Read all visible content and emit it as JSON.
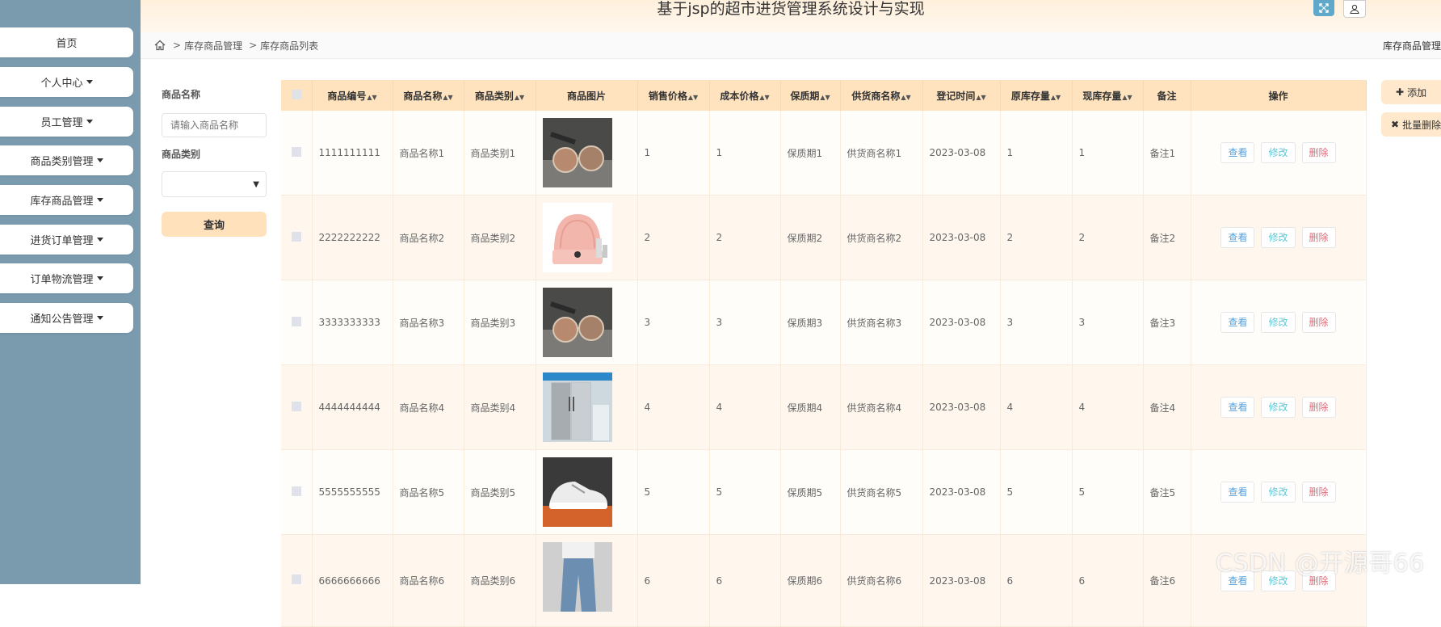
{
  "header": {
    "title": "基于jsp的超市进货管理系统设计与实现"
  },
  "sidebar": {
    "items": [
      {
        "label": "首页",
        "dropdown": false
      },
      {
        "label": "个人中心",
        "dropdown": true
      },
      {
        "label": "员工管理",
        "dropdown": true
      },
      {
        "label": "商品类别管理",
        "dropdown": true
      },
      {
        "label": "库存商品管理",
        "dropdown": true
      },
      {
        "label": "进货订单管理",
        "dropdown": true
      },
      {
        "label": "订单物流管理",
        "dropdown": true
      },
      {
        "label": "通知公告管理",
        "dropdown": true
      }
    ]
  },
  "breadcrumb": {
    "items": [
      "库存商品管理",
      "库存商品列表"
    ],
    "right": "库存商品管理"
  },
  "filter": {
    "name_label": "商品名称",
    "name_placeholder": "请输入商品名称",
    "type_label": "商品类别",
    "query_label": "查询"
  },
  "toolbar": {
    "add_label": "添加",
    "batch_delete_label": "批量删除"
  },
  "table": {
    "headers": [
      "商品编号",
      "商品名称",
      "商品类别",
      "商品图片",
      "销售价格",
      "成本价格",
      "保质期",
      "供货商名称",
      "登记时间",
      "原库存量",
      "现库存量",
      "备注",
      "操作"
    ],
    "actions": {
      "view": "查看",
      "edit": "修改",
      "delete": "删除"
    },
    "rows": [
      {
        "id": "1111111111",
        "name": "商品名称1",
        "category": "商品类别1",
        "image": "sunglasses",
        "sale": "1",
        "cost": "1",
        "shelf": "保质期1",
        "supplier": "供货商名称1",
        "date": "2023-03-08",
        "orig": "1",
        "curr": "1",
        "note": "备注1"
      },
      {
        "id": "2222222222",
        "name": "商品名称2",
        "category": "商品类别2",
        "image": "cosmetics",
        "sale": "2",
        "cost": "2",
        "shelf": "保质期2",
        "supplier": "供货商名称2",
        "date": "2023-03-08",
        "orig": "2",
        "curr": "2",
        "note": "备注2"
      },
      {
        "id": "3333333333",
        "name": "商品名称3",
        "category": "商品类别3",
        "image": "sunglasses",
        "sale": "3",
        "cost": "3",
        "shelf": "保质期3",
        "supplier": "供货商名称3",
        "date": "2023-03-08",
        "orig": "3",
        "curr": "3",
        "note": "备注3"
      },
      {
        "id": "4444444444",
        "name": "商品名称4",
        "category": "商品类别4",
        "image": "refrigerator",
        "sale": "4",
        "cost": "4",
        "shelf": "保质期4",
        "supplier": "供货商名称4",
        "date": "2023-03-08",
        "orig": "4",
        "curr": "4",
        "note": "备注4"
      },
      {
        "id": "5555555555",
        "name": "商品名称5",
        "category": "商品类别5",
        "image": "sneaker",
        "sale": "5",
        "cost": "5",
        "shelf": "保质期5",
        "supplier": "供货商名称5",
        "date": "2023-03-08",
        "orig": "5",
        "curr": "5",
        "note": "备注5"
      },
      {
        "id": "6666666666",
        "name": "商品名称6",
        "category": "商品类别6",
        "image": "jeans",
        "sale": "6",
        "cost": "6",
        "shelf": "保质期6",
        "supplier": "供货商名称6",
        "date": "2023-03-08",
        "orig": "6",
        "curr": "6",
        "note": "备注6"
      }
    ]
  },
  "watermark": "CSDN @开源哥66"
}
